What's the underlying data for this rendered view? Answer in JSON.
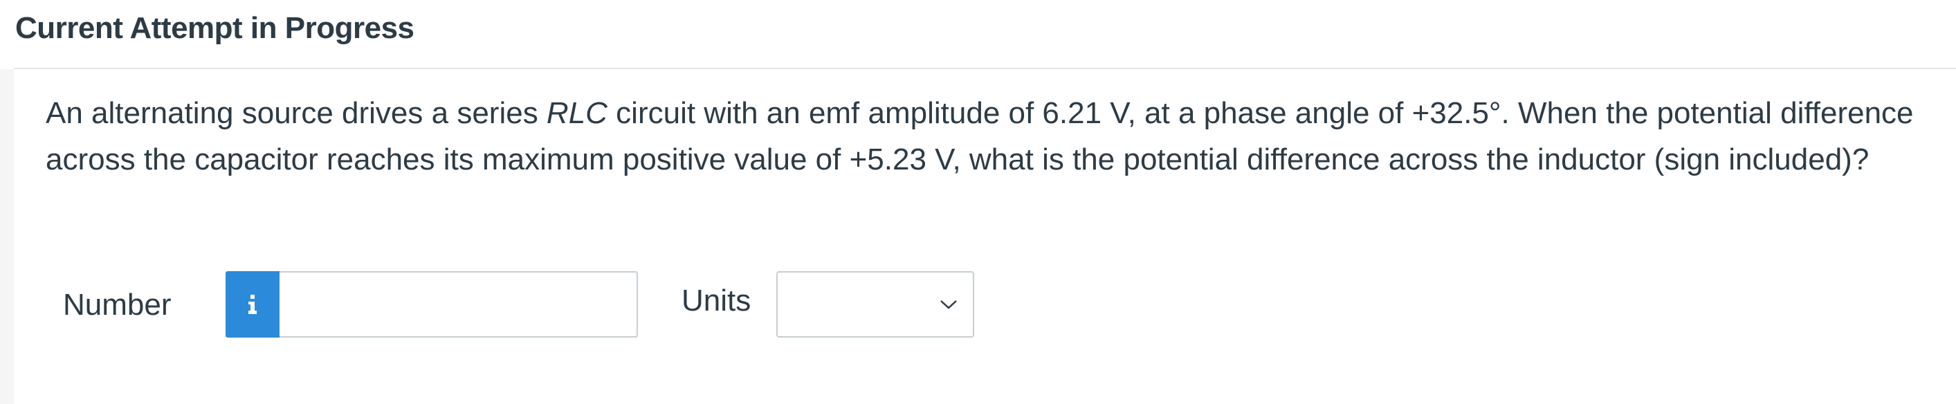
{
  "header": {
    "title": "Current Attempt in Progress"
  },
  "question": {
    "text_1": "An alternating source drives a series ",
    "text_italic": "RLC",
    "text_2": " circuit with an emf amplitude of 6.21 V, at a phase angle of +32.5°. When the potential difference across the capacitor reaches its maximum positive value of +5.23 V, what is the potential difference across the inductor (sign included)?"
  },
  "answer": {
    "number_label": "Number",
    "info_icon": "info-icon",
    "number_value": "",
    "number_placeholder": "",
    "units_label": "Units",
    "units_selected": "",
    "units_icon": "chevron-down-icon"
  },
  "colors": {
    "info_button": "#2b8ad9",
    "text": "#2d3b45",
    "border": "#c7cdd1",
    "divider": "#e6e6e6"
  }
}
